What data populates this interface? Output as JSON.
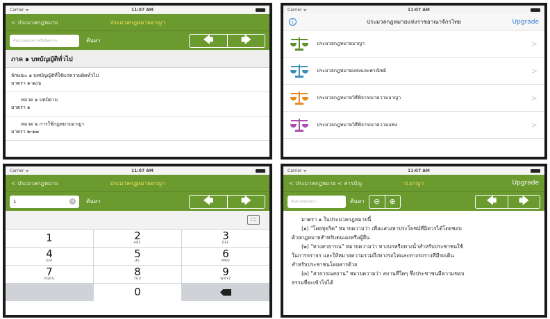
{
  "status": {
    "carrier": "Carrier ᯤ",
    "time": "11:07 AM"
  },
  "screen1": {
    "back": "< ประมวลกฎหมาย",
    "title": "ประมวลกฎหมายอาญา",
    "search_placeholder": "ค้นหาเลขมาตราหรือข้อความ",
    "search_label": "ค้นหา",
    "prev": "🡄",
    "next": "🡆",
    "section_header": "ภาค ๑ บทบัญญัติทั่วไป",
    "rows": [
      {
        "line1": "ลักษณะ ๑ บทบัญญัติที่ใช้แก่ความผิดทั่วไป",
        "line2": "มาตรา ๑-๑๐๖"
      },
      {
        "line1": "หมวด ๑ บทนิยาม",
        "line2": "มาตรา ๑"
      },
      {
        "line1": "หมวด ๒ การใช้กฎหมายอาญา",
        "line2": "มาตรา ๒-๑๗"
      }
    ]
  },
  "screen2": {
    "info": "i",
    "title": "ประมวลกฎหมายแห่งราชอาณาจักรไทย",
    "upgrade": "Upgrade",
    "items": [
      {
        "label": "ประมวลกฎหมายอาญา",
        "color": "#5a8f2a",
        "chevron": ">"
      },
      {
        "label": "ประมวลกฎหมายแพ่งและพาณิชย์",
        "color": "#3d8fb8",
        "chevron": ">"
      },
      {
        "label": "ประมวลกฎหมายวิธีพิจารณาความอาญา",
        "color": "#e88a1f",
        "chevron": ">"
      },
      {
        "label": "ประมวลกฎหมายวิธีพิจารณาความแพ่ง",
        "color": "#a94fb0",
        "chevron": ">"
      }
    ]
  },
  "screen3": {
    "back": "< ประมวลกฎหมาย",
    "title": "ประมวลกฎหมายอาญา",
    "search_value": "1",
    "search_label": "ค้นหา",
    "prev": "🡄",
    "next": "🡆",
    "keys": [
      {
        "num": "1",
        "sub": ""
      },
      {
        "num": "2",
        "sub": "ABC"
      },
      {
        "num": "3",
        "sub": "DEF"
      },
      {
        "num": "4",
        "sub": "GHI"
      },
      {
        "num": "5",
        "sub": "JKL"
      },
      {
        "num": "6",
        "sub": "MNO"
      },
      {
        "num": "7",
        "sub": "PQRS"
      },
      {
        "num": "8",
        "sub": "TUV"
      },
      {
        "num": "9",
        "sub": "WXYZ"
      }
    ],
    "zero": "0"
  },
  "screen4": {
    "back": "< ประมวลกฎหมาย < สารบัญ",
    "title": "ป.อาญา",
    "upgrade": "Upgrade",
    "search_placeholder": "ค้นหาเลขมาตรา...",
    "search_label": "ค้นหา",
    "zoom_out": "⊖",
    "zoom_in": "⊕",
    "prev": "🡄",
    "next": "🡆",
    "lines": [
      "มาตรา ๑ ในประมวลกฎหมายนี้",
      "(๑) \"โดยทุจริต\" หมายความว่า เพื่อแสวงหาประโยชน์ที่มิควรได้โดยชอบ",
      "ด้วยกฎหมายสำหรับตนเองหรือผู้อื่น",
      "(๒) \"ทางสาธารณ\" หมายความว่า ทางบกหรือทางน้ำสำหรับประชาชนใช้",
      "ในการจราจร และให้หมายความรวมถึงทางรถไฟและทางรถรางที่มีรถเดิน",
      "สำหรับประชาชนโดยสารด้วย",
      "(๓) \"สาธารณสถาน\" หมายความว่า สถานที่ใดๆ ซึ่งประชาชนมีความชอบ",
      "ธรรมที่จะเข้าไปได้"
    ]
  }
}
